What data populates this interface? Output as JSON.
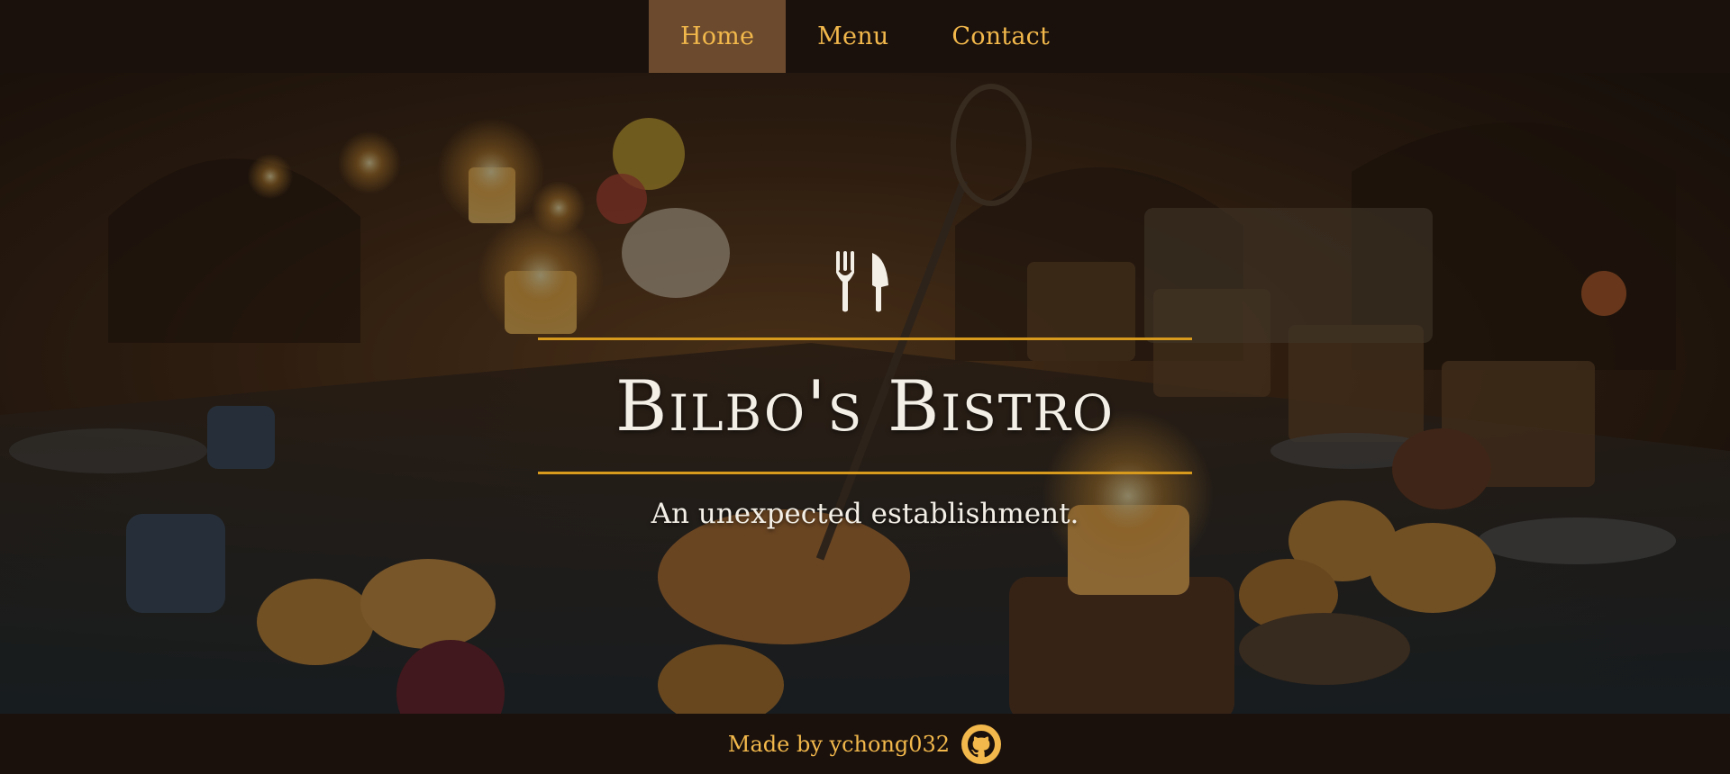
{
  "nav": {
    "items": [
      {
        "label": "Home",
        "active": true
      },
      {
        "label": "Menu",
        "active": false
      },
      {
        "label": "Contact",
        "active": false
      }
    ]
  },
  "hero": {
    "icon": "fork-knife-icon",
    "title": "Bilbo's Bistro",
    "tagline": "An unexpected establishment."
  },
  "footer": {
    "text": "Made by ychong032",
    "icon": "github-icon"
  },
  "colors": {
    "accent": "#f2b84b",
    "nav_active_bg": "#6b4a2e",
    "bar_bg": "#1a110d",
    "rule": "#d79a1c",
    "hero_text": "#f3efe7"
  }
}
